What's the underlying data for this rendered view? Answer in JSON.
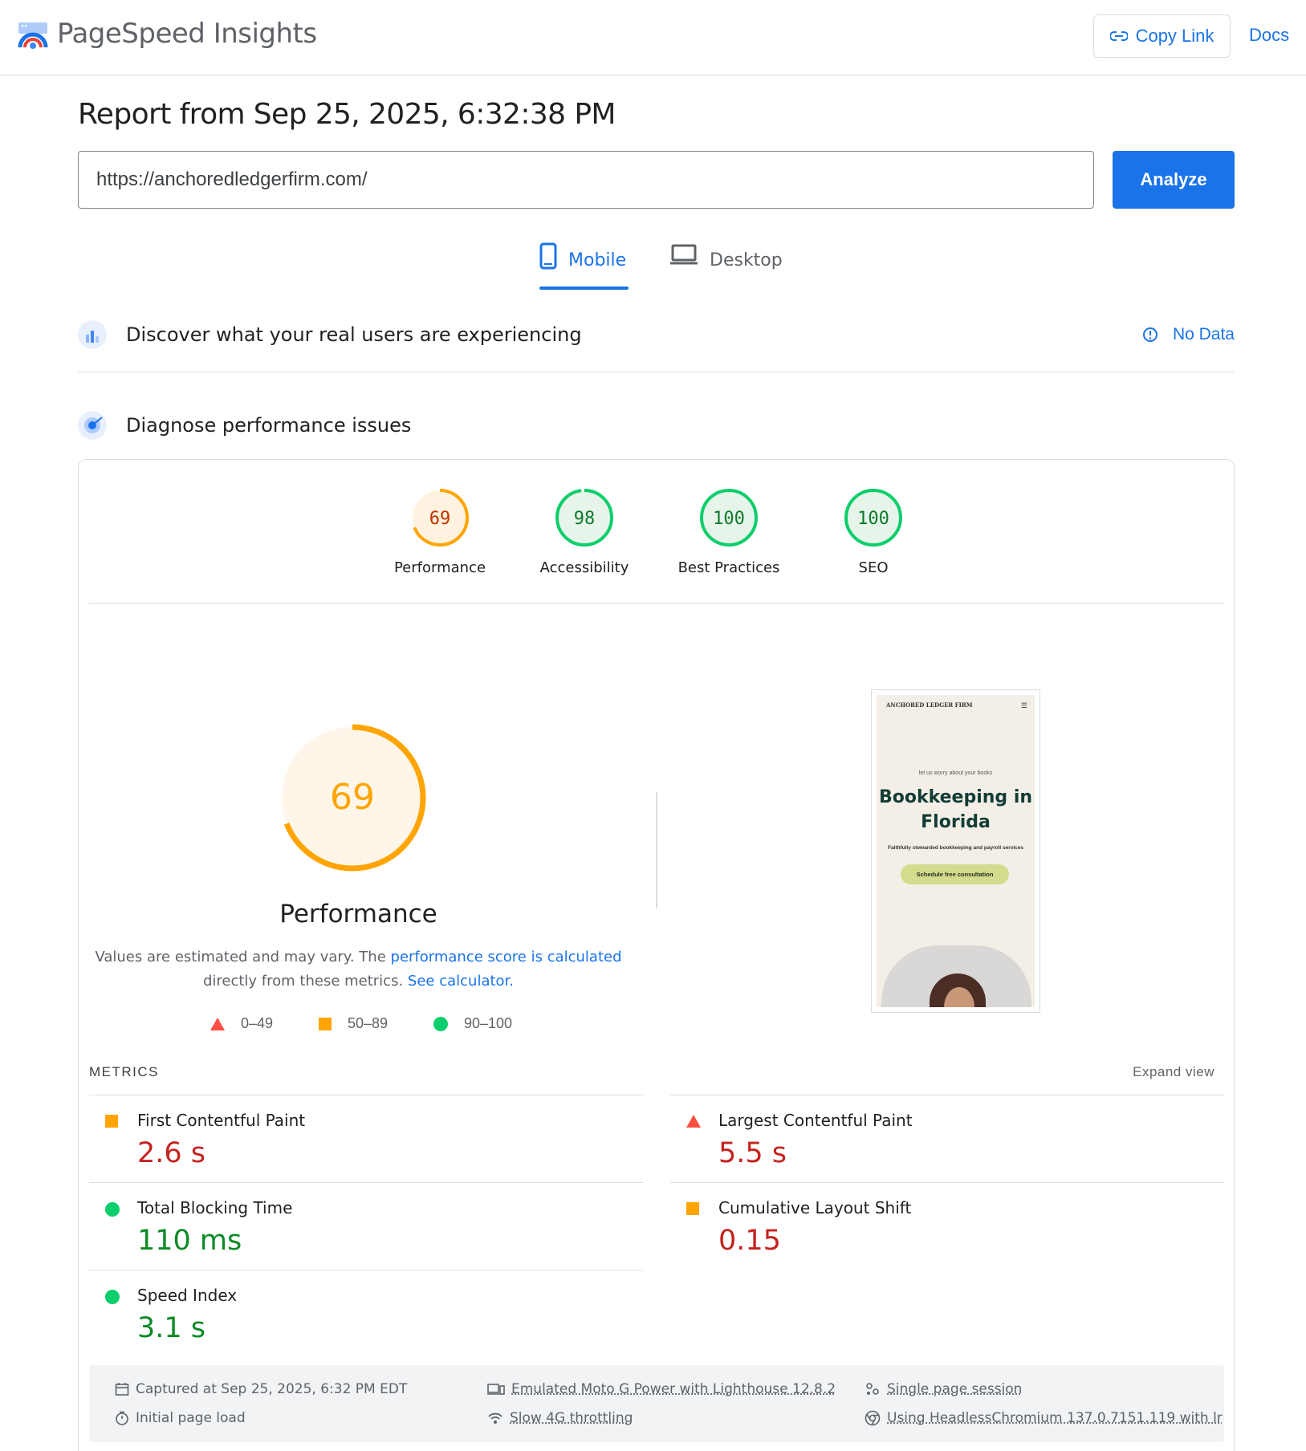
{
  "header": {
    "app_title": "PageSpeed Insights",
    "copy_link_label": "Copy Link",
    "docs_label": "Docs"
  },
  "report": {
    "title": "Report from Sep 25, 2025, 6:32:38 PM",
    "url_value": "https://anchoredledgerfirm.com/",
    "analyze_label": "Analyze"
  },
  "tabs": {
    "mobile": "Mobile",
    "desktop": "Desktop",
    "active": "mobile"
  },
  "field_data": {
    "title": "Discover what your real users are experiencing",
    "status": "No Data"
  },
  "lab": {
    "title": "Diagnose performance issues",
    "categories": [
      {
        "label": "Performance",
        "score": "69",
        "level": "average"
      },
      {
        "label": "Accessibility",
        "score": "98",
        "level": "pass"
      },
      {
        "label": "Best Practices",
        "score": "100",
        "level": "pass"
      },
      {
        "label": "SEO",
        "score": "100",
        "level": "pass"
      }
    ],
    "performance_score": "69",
    "performance_label": "Performance",
    "note_text": "Values are estimated and may vary. The ",
    "note_link1": "performance score is calculated",
    "note_text2": "directly from these metrics.",
    "note_link2": "See calculator.",
    "legend": {
      "fail": "0–49",
      "average": "50–89",
      "pass": "90–100"
    }
  },
  "screenshot": {
    "brand": "ANCHORED LEDGER FIRM",
    "tagline": "let us worry about your books",
    "headline_1": "Bookkeeping in",
    "headline_2": "Florida",
    "subtitle": "Faithfully stewarded bookkeeping and payroll services",
    "cta": "Schedule free consultation"
  },
  "metrics": {
    "title": "METRICS",
    "expand_label": "Expand view",
    "items": [
      {
        "name": "First Contentful Paint",
        "value": "2.6 s",
        "level": "average"
      },
      {
        "name": "Largest Contentful Paint",
        "value": "5.5 s",
        "level": "fail"
      },
      {
        "name": "Total Blocking Time",
        "value": "110 ms",
        "level": "pass"
      },
      {
        "name": "Cumulative Layout Shift",
        "value": "0.15",
        "level": "average"
      },
      {
        "name": "Speed Index",
        "value": "3.1 s",
        "level": "pass"
      }
    ]
  },
  "run_info": {
    "captured": "Captured at Sep 25, 2025, 6:32 PM EDT",
    "initial_load": "Initial page load",
    "emulated": "Emulated Moto G Power with Lighthouse 12.8.2",
    "throttling": "Slow 4G throttling",
    "session": "Single page session",
    "browser": "Using HeadlessChromium 137.0.7151.119 with lr"
  },
  "colors": {
    "accent": "#1a73e8",
    "pass": "#0cce6b",
    "average": "#ffa400",
    "fail": "#ff4e42"
  }
}
